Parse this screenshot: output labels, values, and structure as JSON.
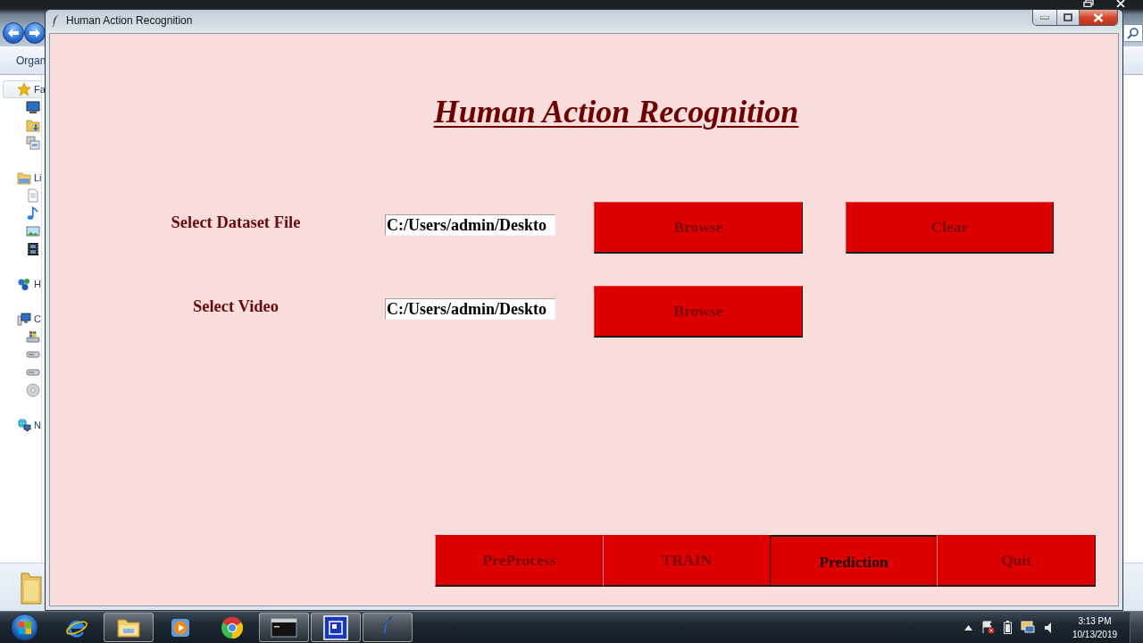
{
  "desktop_window": {
    "toolbar_label": "Organ",
    "nav_groups": [
      {
        "label": "Fa",
        "selected": true
      },
      {
        "label": "Li",
        "selected": false
      },
      {
        "label": "H",
        "selected": false
      },
      {
        "label": "C",
        "selected": false
      },
      {
        "label": "N",
        "selected": false
      }
    ]
  },
  "window": {
    "title": "Human Action Recognition"
  },
  "app": {
    "heading": "Human Action Recognition",
    "rows": [
      {
        "label": "Select Dataset File",
        "path": "C:/Users/admin/Deskto",
        "buttons": [
          "Browse",
          "Clear"
        ]
      },
      {
        "label": "Select Video",
        "path": "C:/Users/admin/Deskto",
        "buttons": [
          "Browse"
        ]
      }
    ],
    "actions": [
      {
        "label": "PreProcess",
        "pressed": false
      },
      {
        "label": "TRAIN",
        "pressed": false
      },
      {
        "label": "Prediction",
        "pressed": true
      },
      {
        "label": "Quit",
        "pressed": false
      }
    ]
  },
  "taskbar": {
    "apps": [
      {
        "kind": "browser",
        "running": false
      },
      {
        "kind": "folder",
        "running": true
      },
      {
        "kind": "media",
        "running": false
      },
      {
        "kind": "tricolor",
        "running": false
      },
      {
        "kind": "terminal",
        "running": true
      },
      {
        "kind": "squares",
        "running": true
      },
      {
        "kind": "feather",
        "running": true
      }
    ],
    "time": "3:13 PM",
    "date": "10/13/2019"
  }
}
